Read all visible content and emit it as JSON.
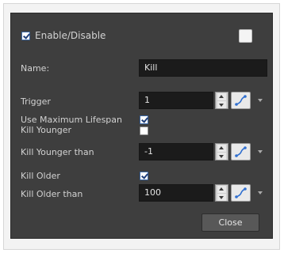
{
  "dialog": {
    "enable": {
      "label": "Enable/Disable",
      "checked": true
    },
    "name": {
      "label": "Name:",
      "value": "Kill"
    },
    "trigger": {
      "label": "Trigger",
      "value": "1"
    },
    "use_max_lifespan": {
      "label": "Use Maximum Lifespan",
      "checked": true
    },
    "kill_younger": {
      "label": "Kill Younger",
      "checked": false
    },
    "kill_younger_than": {
      "label": "Kill Younger than",
      "value": "-1"
    },
    "kill_older": {
      "label": "Kill Older",
      "checked": true
    },
    "kill_older_than": {
      "label": "Kill Older than",
      "value": "100"
    },
    "close_label": "Close"
  },
  "icons": {
    "function": "function-curve-icon",
    "spinner": "spinner-arrows-icon",
    "dropdown": "chevron-down-icon"
  },
  "colors": {
    "panel_bg": "#3e3e3e",
    "field_bg": "#1b1b1b",
    "label_text": "#d2d2d2",
    "function_accent": "#2f6fd0"
  }
}
